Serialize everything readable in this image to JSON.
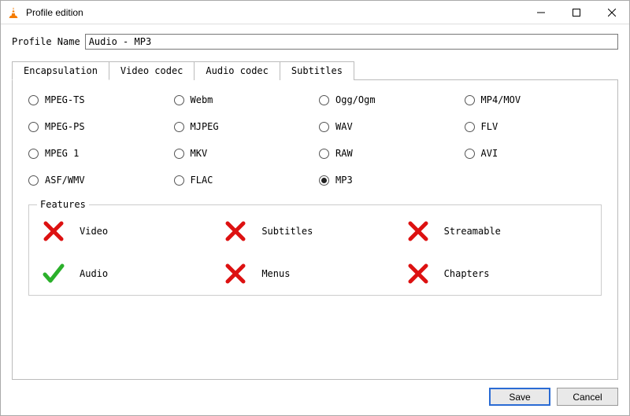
{
  "window": {
    "title": "Profile edition"
  },
  "profile": {
    "name_label": "Profile Name",
    "name_value": "Audio - MP3"
  },
  "tabs": [
    {
      "label": "Encapsulation"
    },
    {
      "label": "Video codec"
    },
    {
      "label": "Audio codec"
    },
    {
      "label": "Subtitles"
    }
  ],
  "active_tab": 0,
  "formats": [
    {
      "label": "MPEG-TS",
      "selected": false
    },
    {
      "label": "Webm",
      "selected": false
    },
    {
      "label": "Ogg/Ogm",
      "selected": false
    },
    {
      "label": "MP4/MOV",
      "selected": false
    },
    {
      "label": "MPEG-PS",
      "selected": false
    },
    {
      "label": "MJPEG",
      "selected": false
    },
    {
      "label": "WAV",
      "selected": false
    },
    {
      "label": "FLV",
      "selected": false
    },
    {
      "label": "MPEG 1",
      "selected": false
    },
    {
      "label": "MKV",
      "selected": false
    },
    {
      "label": "RAW",
      "selected": false
    },
    {
      "label": "AVI",
      "selected": false
    },
    {
      "label": "ASF/WMV",
      "selected": false
    },
    {
      "label": "FLAC",
      "selected": false
    },
    {
      "label": "MP3",
      "selected": true
    }
  ],
  "features_title": "Features",
  "features": [
    {
      "label": "Video",
      "supported": false
    },
    {
      "label": "Subtitles",
      "supported": false
    },
    {
      "label": "Streamable",
      "supported": false
    },
    {
      "label": "Audio",
      "supported": true
    },
    {
      "label": "Menus",
      "supported": false
    },
    {
      "label": "Chapters",
      "supported": false
    }
  ],
  "buttons": {
    "save": "Save",
    "cancel": "Cancel"
  }
}
